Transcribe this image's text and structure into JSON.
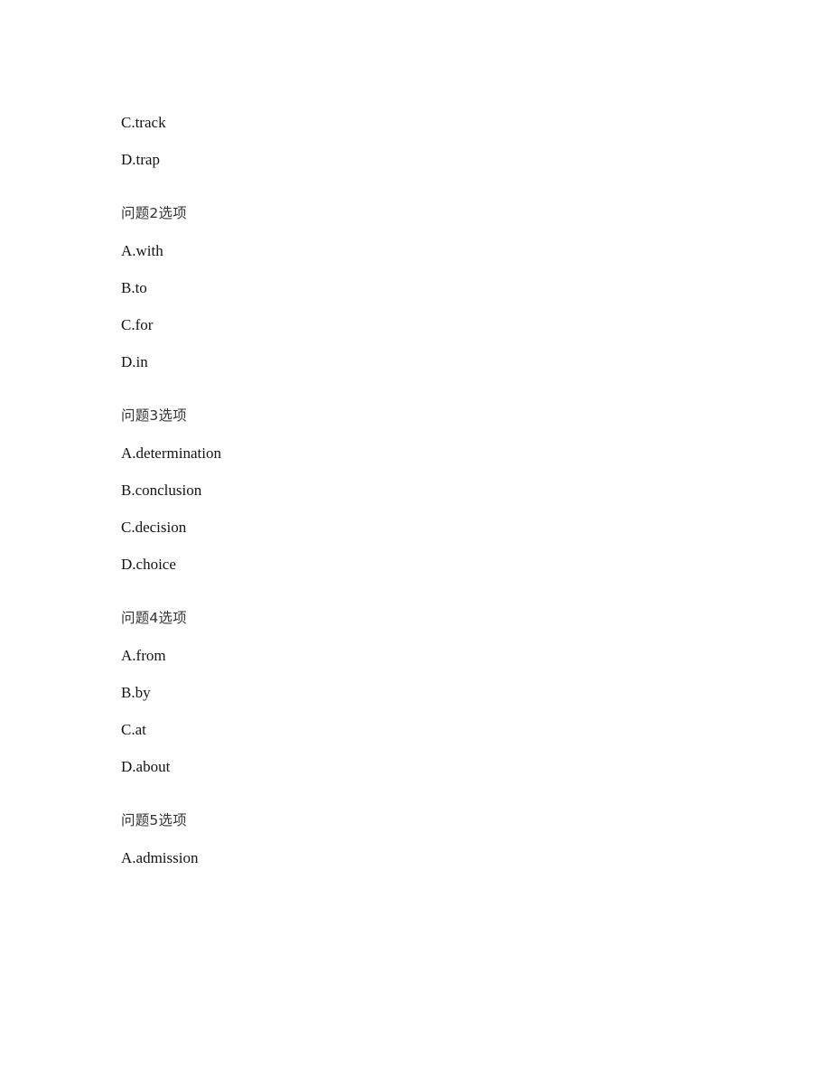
{
  "document": {
    "type": "exam-options-page",
    "background_color": "#ffffff",
    "text_color": "#141414",
    "heading_color": "#333333"
  },
  "groups": [
    {
      "id": "question-1-continued",
      "heading": "",
      "has_heading": false,
      "options": [
        "C.track",
        "D.trap"
      ]
    },
    {
      "id": "question-2",
      "heading": "问题2选项",
      "has_heading": true,
      "options": [
        "A.with",
        "B.to",
        "C.for",
        "D.in"
      ]
    },
    {
      "id": "question-3",
      "heading": "问题3选项",
      "has_heading": true,
      "options": [
        "A.determination",
        "B.conclusion",
        "C.decision",
        "D.choice"
      ]
    },
    {
      "id": "question-4",
      "heading": "问题4选项",
      "has_heading": true,
      "options": [
        "A.from",
        "B.by",
        "C.at",
        "D.about"
      ]
    },
    {
      "id": "question-5",
      "heading": "问题5选项",
      "has_heading": true,
      "options": [
        "A.admission"
      ]
    }
  ]
}
